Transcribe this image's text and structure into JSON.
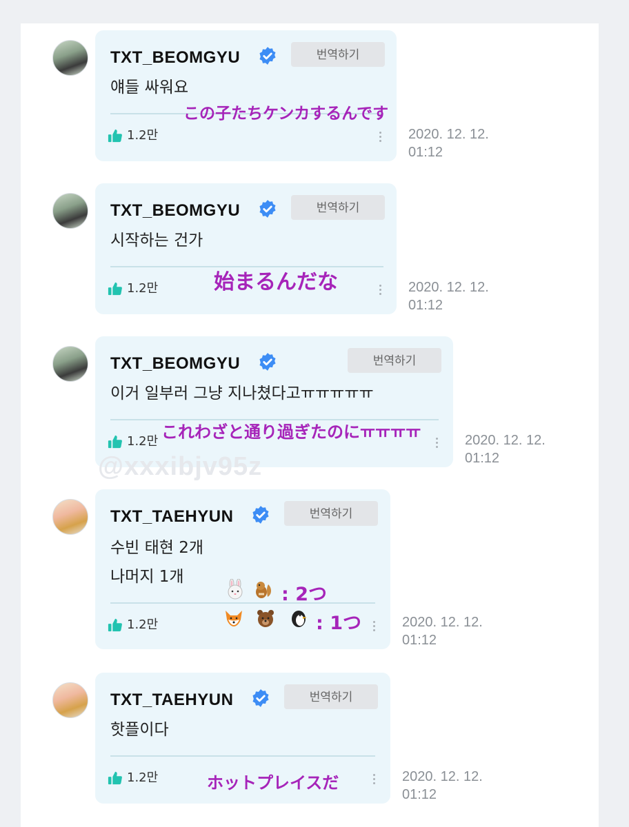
{
  "watermark": "@xxxibjv95z",
  "translate_label": "번역하기",
  "comments": [
    {
      "username": "TXT_BEOMGYU",
      "lines": [
        "얘들 싸워요"
      ],
      "translation": "この子たちケンカするんです",
      "likes": "1.2만",
      "date": "2020. 12. 12.",
      "time": "01:12"
    },
    {
      "username": "TXT_BEOMGYU",
      "lines": [
        "시작하는 건가"
      ],
      "translation": "始まるんだな",
      "likes": "1.2만",
      "date": "2020. 12. 12.",
      "time": "01:12"
    },
    {
      "username": "TXT_BEOMGYU",
      "lines": [
        "이거 일부러 그냥 지나쳤다고ㅠㅠㅠㅠㅠ"
      ],
      "translation": "これわざと通り過ぎたのにㅠㅠㅠㅠ",
      "likes": "1.2만",
      "date": "2020. 12. 12.",
      "time": "01:12"
    },
    {
      "username": "TXT_TAEHYUN",
      "lines": [
        "수빈 태현 2개",
        "나머지 1개"
      ],
      "translation_1": ": 2つ",
      "translation_2": ": 1つ",
      "likes": "1.2만",
      "date": "2020. 12. 12.",
      "time": "01:12"
    },
    {
      "username": "TXT_TAEHYUN",
      "lines": [
        "핫플이다"
      ],
      "translation": "ホットプレイスだ",
      "likes": "1.2만",
      "date": "2020. 12. 12.",
      "time": "01:12"
    }
  ],
  "icons": {
    "verified": "verified-badge-icon",
    "like": "thumbs-up-icon",
    "more": "more-vertical-icon",
    "emoji_group_1": [
      "rabbit-icon",
      "chipmunk-icon"
    ],
    "emoji_group_2": [
      "fox-icon",
      "bear-icon",
      "penguin-icon"
    ]
  },
  "colors": {
    "bubble": "#ebf6fb",
    "overlay_text": "#a624b9",
    "verified_badge": "#3d8df5",
    "like_icon": "#22c3b0"
  }
}
